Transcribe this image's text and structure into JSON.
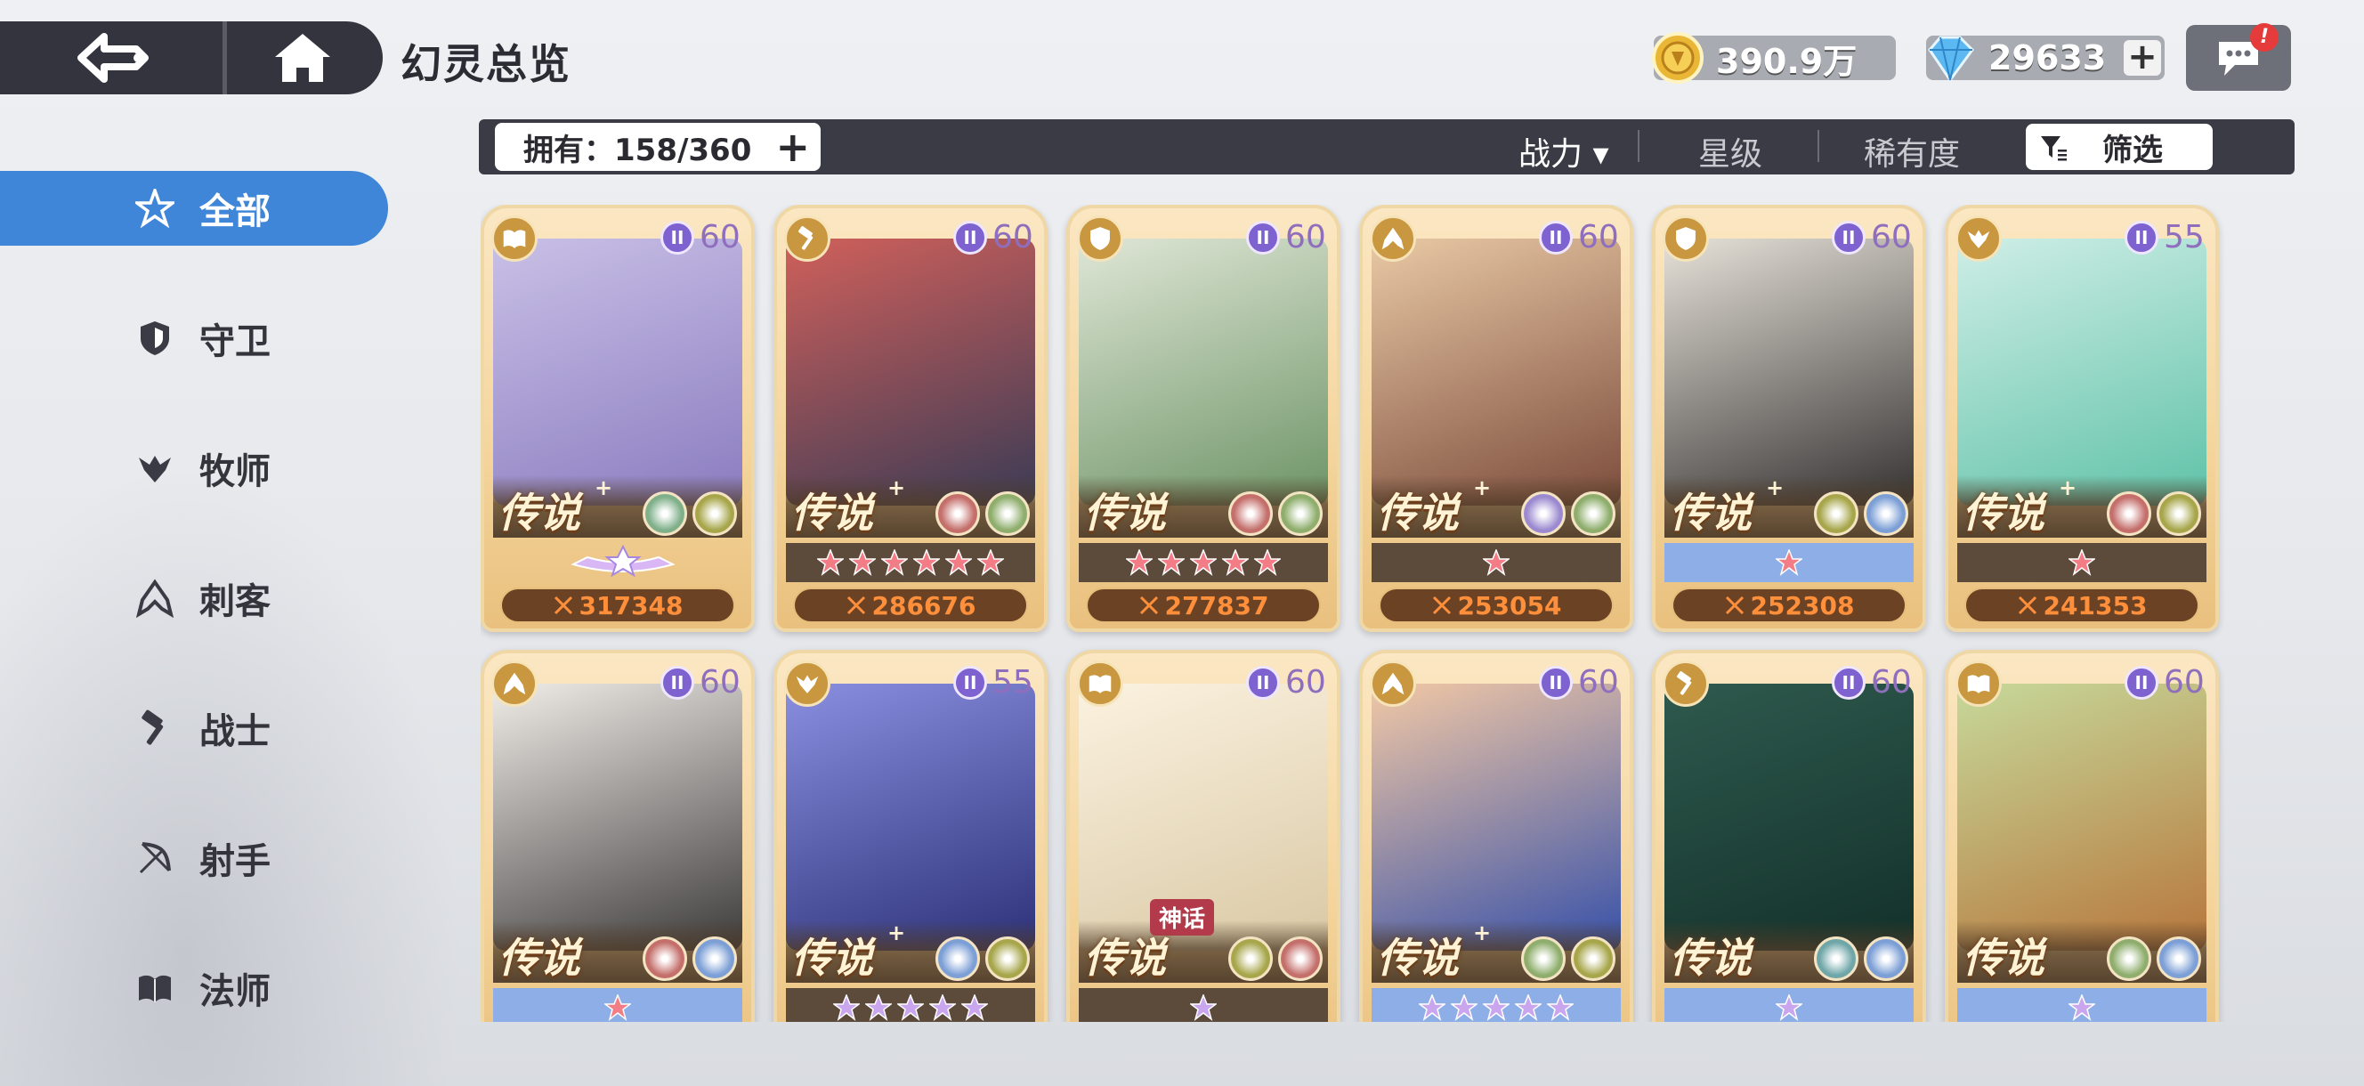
{
  "header": {
    "title": "幻灵总览",
    "back_icon": "back-arrow-icon",
    "home_icon": "home-icon"
  },
  "currency": {
    "gold": "390.9万",
    "gems": "29633",
    "plus": "+"
  },
  "chat": {
    "badge": "!"
  },
  "filter_bar": {
    "owned_label": "拥有：158/360",
    "sort": [
      {
        "label": "战力 ▾",
        "active": true
      },
      {
        "label": "星级",
        "active": false
      },
      {
        "label": "稀有度",
        "active": false
      }
    ],
    "filter_label": "筛选"
  },
  "sidebar": {
    "items": [
      {
        "label": "全部",
        "icon": "all-star-icon",
        "active": true
      },
      {
        "label": "守卫",
        "icon": "shield-icon",
        "active": false
      },
      {
        "label": "牧师",
        "icon": "wing-icon",
        "active": false
      },
      {
        "label": "刺客",
        "icon": "hood-icon",
        "active": false
      },
      {
        "label": "战士",
        "icon": "hammer-icon",
        "active": false
      },
      {
        "label": "射手",
        "icon": "bow-icon",
        "active": false
      },
      {
        "label": "法师",
        "icon": "book-icon",
        "active": false
      }
    ]
  },
  "cards": [
    {
      "class": "book-icon",
      "tier": "II",
      "level": "60",
      "rarity": "传说",
      "plus": "+",
      "elements": [
        "#7fb08a",
        "#a7a64b"
      ],
      "stars": 0,
      "star_color": "#f27d86",
      "row": "pedestal",
      "power": "317348",
      "portrait": [
        "#c9c0e6",
        "#8a7cc0"
      ]
    },
    {
      "class": "hammer-icon",
      "tier": "II",
      "level": "60",
      "rarity": "传说",
      "plus": "+",
      "elements": [
        "#c46f6b",
        "#8fae6d"
      ],
      "stars": 6,
      "star_color": "#f27d86",
      "row": "dark",
      "power": "286676",
      "portrait": [
        "#d0605b",
        "#3a3b55"
      ]
    },
    {
      "class": "shield-icon",
      "tier": "II",
      "level": "60",
      "rarity": "传说",
      "plus": "",
      "elements": [
        "#c46f6b",
        "#8fae6d"
      ],
      "stars": 5,
      "star_color": "#f27d86",
      "row": "dark",
      "power": "277837",
      "portrait": [
        "#dfe6d6",
        "#6d9466"
      ]
    },
    {
      "class": "hood-icon",
      "tier": "II",
      "level": "60",
      "rarity": "传说",
      "plus": "+",
      "elements": [
        "#9c8ad0",
        "#8fae6d"
      ],
      "stars": 1,
      "star_color": "#f27d86",
      "row": "dark",
      "power": "253054",
      "portrait": [
        "#e9c9a5",
        "#7b4b3b"
      ]
    },
    {
      "class": "shield-icon",
      "tier": "II",
      "level": "60",
      "rarity": "传说",
      "plus": "+",
      "elements": [
        "#a7a64b",
        "#7c9fd6"
      ],
      "stars": 1,
      "star_color": "#f27d86",
      "row": "blue",
      "power": "252308",
      "portrait": [
        "#e6e1d8",
        "#343232"
      ]
    },
    {
      "class": "wing-icon",
      "tier": "II",
      "level": "55",
      "rarity": "传说",
      "plus": "+",
      "elements": [
        "#c46f6b",
        "#a7a64b"
      ],
      "stars": 1,
      "star_color": "#f27d86",
      "row": "dark",
      "power": "241353",
      "portrait": [
        "#cfeee6",
        "#5fc2a8"
      ]
    },
    {
      "class": "hood-icon",
      "tier": "II",
      "level": "60",
      "rarity": "传说",
      "plus": "",
      "elements": [
        "#c46f6b",
        "#7c9fd6"
      ],
      "stars": 1,
      "star_color": "#f27d86",
      "row": "blue",
      "power": "",
      "portrait": [
        "#f0ede8",
        "#3c3a3a"
      ]
    },
    {
      "class": "wing-icon",
      "tier": "II",
      "level": "55",
      "rarity": "传说",
      "plus": "+",
      "elements": [
        "#7c9fd6",
        "#a7a64b"
      ],
      "stars": 5,
      "star_color": "#c9a6ee",
      "row": "dark",
      "power": "",
      "portrait": [
        "#8a8fe0",
        "#2c3178"
      ]
    },
    {
      "class": "book-icon",
      "tier": "II",
      "level": "60",
      "rarity": "传说",
      "plus": "",
      "myth": "神话",
      "elements": [
        "#a7a64b",
        "#c46f6b"
      ],
      "stars": 1,
      "star_color": "#c9a6ee",
      "row": "dark",
      "power": "",
      "portrait": [
        "#fbf2e0",
        "#d9c8a4"
      ]
    },
    {
      "class": "hood-icon",
      "tier": "II",
      "level": "60",
      "rarity": "传说",
      "plus": "+",
      "elements": [
        "#8fae6d",
        "#a7a64b"
      ],
      "stars": 5,
      "star_color": "#c9a6ee",
      "row": "blue",
      "power": "",
      "portrait": [
        "#f2c8a5",
        "#3650a8"
      ]
    },
    {
      "class": "hammer-icon",
      "tier": "II",
      "level": "60",
      "rarity": "传说",
      "plus": "",
      "elements": [
        "#6fa6a8",
        "#7c9fd6"
      ],
      "stars": 1,
      "star_color": "#c9a6ee",
      "row": "blue",
      "power": "",
      "portrait": [
        "#2f5a4e",
        "#123029"
      ]
    },
    {
      "class": "book-icon",
      "tier": "II",
      "level": "60",
      "rarity": "传说",
      "plus": "",
      "elements": [
        "#8fae6d",
        "#7c9fd6"
      ],
      "stars": 1,
      "star_color": "#c9a6ee",
      "row": "blue",
      "power": "",
      "portrait": [
        "#c6d99a",
        "#b7763c"
      ]
    }
  ]
}
